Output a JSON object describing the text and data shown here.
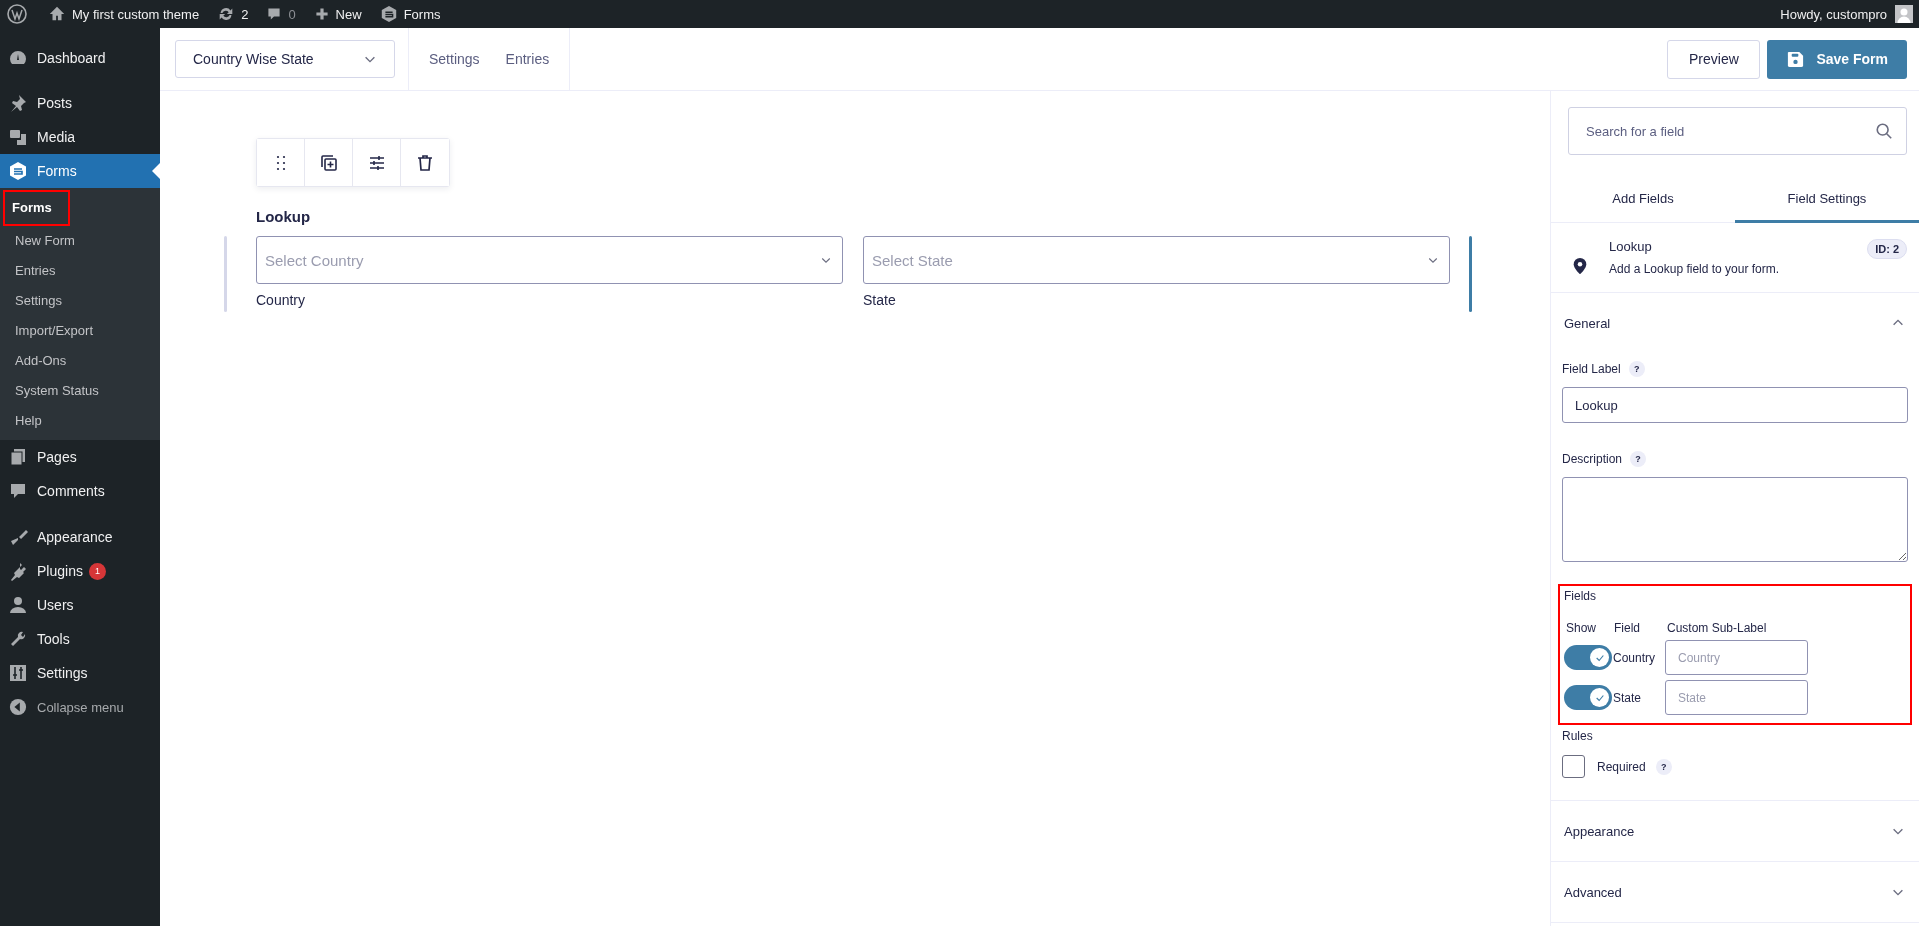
{
  "admin_bar": {
    "site": "My first custom theme",
    "updates": "2",
    "comments": "0",
    "new": "New",
    "plugin": "Forms",
    "greeting": "Howdy, custompro"
  },
  "sidebar": {
    "items": [
      {
        "label": "Dashboard",
        "selected": false
      },
      {
        "label": "Posts",
        "selected": false
      },
      {
        "label": "Media",
        "selected": false
      },
      {
        "label": "Forms",
        "selected": true,
        "children": [
          {
            "label": "Forms",
            "selected": true,
            "highlighted": true
          },
          {
            "label": "New Form",
            "selected": false,
            "highlighted": false
          },
          {
            "label": "Entries",
            "selected": false,
            "highlighted": false
          },
          {
            "label": "Settings",
            "selected": false,
            "highlighted": false
          },
          {
            "label": "Import/Export",
            "selected": false,
            "highlighted": false
          },
          {
            "label": "Add-Ons",
            "selected": false,
            "highlighted": false
          },
          {
            "label": "System Status",
            "selected": false,
            "highlighted": false
          },
          {
            "label": "Help",
            "selected": false,
            "highlighted": false
          }
        ]
      },
      {
        "label": "Pages",
        "selected": false
      },
      {
        "label": "Comments",
        "selected": false
      },
      {
        "label": "Appearance",
        "selected": false
      },
      {
        "label": "Plugins",
        "selected": false,
        "badge": "1"
      },
      {
        "label": "Users",
        "selected": false
      },
      {
        "label": "Tools",
        "selected": false
      },
      {
        "label": "Settings",
        "selected": false
      }
    ],
    "collapse": "Collapse menu"
  },
  "header": {
    "form_select": "Country Wise State",
    "links": [
      "Settings",
      "Entries"
    ],
    "preview": "Preview",
    "save": "Save Form"
  },
  "canvas": {
    "field_label": "Lookup",
    "inputs": [
      {
        "placeholder": "Select Country",
        "sublabel": "Country"
      },
      {
        "placeholder": "Select State",
        "sublabel": "State"
      }
    ]
  },
  "panel": {
    "search": {
      "placeholder": "Search for a field"
    },
    "tabs": [
      {
        "label": "Add Fields",
        "selected": false
      },
      {
        "label": "Field Settings",
        "selected": true
      }
    ],
    "field_info": {
      "title": "Lookup",
      "description": "Add a Lookup field to your form.",
      "id": "ID: 2"
    },
    "sections": [
      {
        "title": "General",
        "expanded": true
      },
      {
        "title": "Appearance",
        "expanded": false
      },
      {
        "title": "Advanced",
        "expanded": false
      }
    ],
    "general": {
      "field_label": {
        "label": "Field Label",
        "help": "?",
        "value": "Lookup"
      },
      "description": {
        "label": "Description",
        "help": "?"
      },
      "fields": {
        "title": "Fields",
        "highlighted": true,
        "columns": [
          "Show",
          "Field",
          "Custom Sub-Label"
        ],
        "rows": [
          {
            "on": true,
            "name": "Country",
            "placeholder": "Country"
          },
          {
            "on": true,
            "name": "State",
            "placeholder": "State"
          }
        ]
      },
      "rules": {
        "title": "Rules",
        "required": {
          "label": "Required",
          "checked": false,
          "help": "?"
        }
      }
    }
  }
}
